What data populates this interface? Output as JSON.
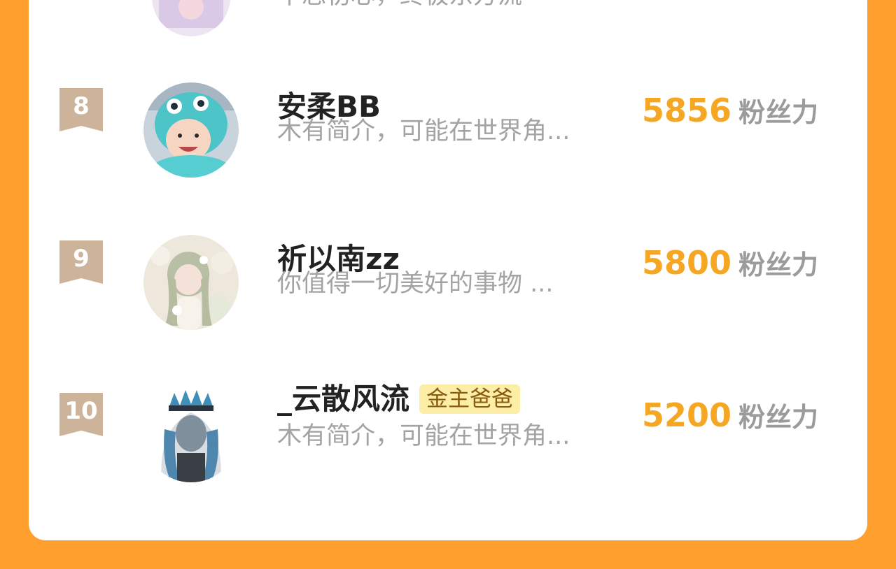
{
  "colors": {
    "background": "#FF9F2E",
    "card": "#ffffff",
    "score": "#F5A623",
    "rank_badge": "#CDB39A",
    "tag_bg": "#FCEEA6"
  },
  "partial_row": {
    "bio": "不忘初心，终极东方流"
  },
  "rows": [
    {
      "rank": "8",
      "name": "安柔BB",
      "bio": "木有简介，可能在世界角...",
      "score": "5856",
      "unit": "粉丝力",
      "avatar": "child-in-hood-avatar"
    },
    {
      "rank": "9",
      "name": "祈以南zz",
      "bio": "你值得一切美好的事物 ...",
      "score": "5800",
      "unit": "粉丝力",
      "avatar": "anime-girl-flowers-avatar"
    },
    {
      "rank": "10",
      "name": "_云散风流",
      "tag": "金主爸爸",
      "bio": "木有简介，可能在世界角...",
      "score": "5200",
      "unit": "粉丝力",
      "avatar": "anime-character-crown-avatar"
    }
  ]
}
